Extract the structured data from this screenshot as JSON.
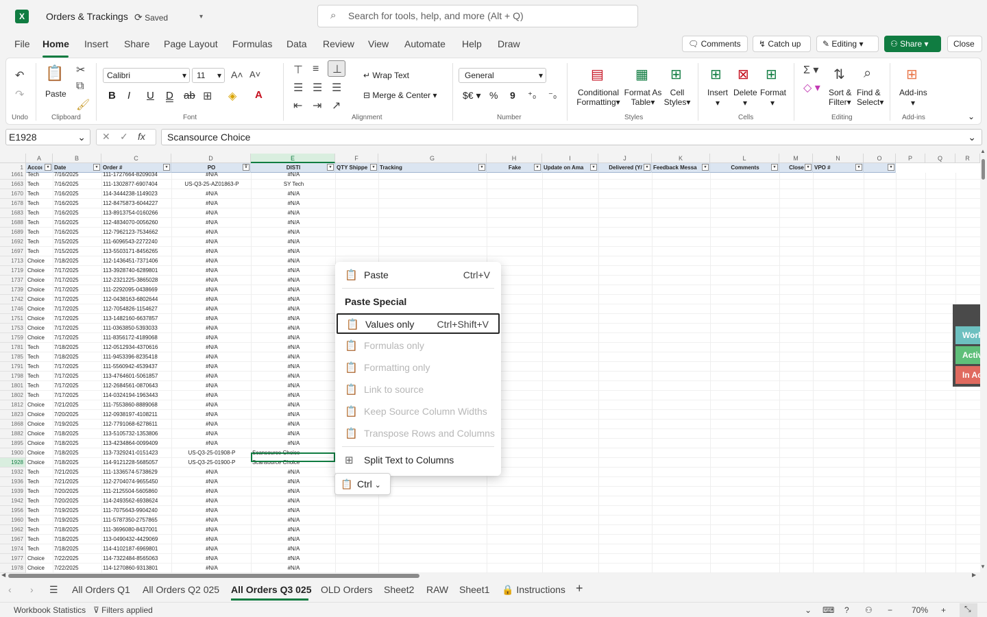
{
  "title_bar": {
    "app_logo": "X",
    "doc_title": "Orders & Trackings",
    "saved_label": "Saved",
    "search_placeholder": "Search for tools, help, and more (Alt + Q)"
  },
  "menu": [
    "File",
    "Home",
    "Insert",
    "Share",
    "Page Layout",
    "Formulas",
    "Data",
    "Review",
    "View",
    "Automate",
    "Help",
    "Draw"
  ],
  "top_buttons": {
    "comments": "Comments",
    "catch_up": "Catch up",
    "editing": "Editing",
    "share": "Share",
    "close": "Close"
  },
  "ribbon": {
    "undo_group": "Undo",
    "paste": "Paste",
    "clipboard_group": "Clipboard",
    "font_name": "Calibri",
    "font_size": "11",
    "font_group": "Font",
    "wrap_text": "Wrap Text",
    "merge_center": "Merge & Center",
    "alignment_group": "Alignment",
    "number_format": "General",
    "number_group": "Number",
    "conditional_formatting": "Conditional",
    "conditional_formatting2": "Formatting",
    "format_as_table": "Format As",
    "format_as_table2": "Table",
    "cell_styles": "Cell",
    "cell_styles2": "Styles",
    "styles_group": "Styles",
    "insert": "Insert",
    "delete": "Delete",
    "format": "Format",
    "cells_group": "Cells",
    "sort_filter": "Sort &",
    "sort_filter2": "Filter",
    "find_select": "Find &",
    "find_select2": "Select",
    "editing_group": "Editing",
    "addins": "Add-ins",
    "addins_group": "Add-ins"
  },
  "formula_bar": {
    "name_box": "E1928",
    "fx": "fx",
    "value": "Scansource Choice"
  },
  "columns": [
    "A",
    "B",
    "C",
    "D",
    "E",
    "F",
    "G",
    "H",
    "I",
    "J",
    "K",
    "L",
    "M",
    "N",
    "O",
    "P",
    "Q",
    "R"
  ],
  "header_row": {
    "row_num": "1",
    "cells": [
      "Accoι",
      "Date",
      "Order #",
      "PO",
      "DISTI",
      "QTY Shippe",
      "Tracking",
      "Fake",
      "Update on Ama",
      "Delivered (Y/",
      "Feedback Messa",
      "Comments",
      "Close",
      "VPO #",
      ""
    ]
  },
  "rows": [
    {
      "n": "1661",
      "a": "Tech",
      "b": "7/16/2025",
      "c": "111-1727664-8209034",
      "d": "#N/A",
      "e": "#N/A"
    },
    {
      "n": "1663",
      "a": "Tech",
      "b": "7/16/2025",
      "c": "111-1302877-6907404",
      "d": "US-Q3-25-AZ01863-P",
      "e": "SY Tech"
    },
    {
      "n": "1670",
      "a": "Tech",
      "b": "7/16/2025",
      "c": "114-3444238-1149023",
      "d": "#N/A",
      "e": "#N/A"
    },
    {
      "n": "1678",
      "a": "Tech",
      "b": "7/16/2025",
      "c": "112-8475873-6044227",
      "d": "#N/A",
      "e": "#N/A"
    },
    {
      "n": "1683",
      "a": "Tech",
      "b": "7/16/2025",
      "c": "113-8913754-0160266",
      "d": "#N/A",
      "e": "#N/A"
    },
    {
      "n": "1688",
      "a": "Tech",
      "b": "7/16/2025",
      "c": "112-4834070-0056260",
      "d": "#N/A",
      "e": "#N/A"
    },
    {
      "n": "1689",
      "a": "Tech",
      "b": "7/16/2025",
      "c": "112-7962123-7534662",
      "d": "#N/A",
      "e": "#N/A"
    },
    {
      "n": "1692",
      "a": "Tech",
      "b": "7/15/2025",
      "c": "111-6096543-2272240",
      "d": "#N/A",
      "e": "#N/A"
    },
    {
      "n": "1697",
      "a": "Tech",
      "b": "7/15/2025",
      "c": "113-5503171-8456265",
      "d": "#N/A",
      "e": "#N/A"
    },
    {
      "n": "1713",
      "a": "Choice",
      "b": "7/18/2025",
      "c": "112-1436451-7371406",
      "d": "#N/A",
      "e": "#N/A"
    },
    {
      "n": "1719",
      "a": "Choice",
      "b": "7/17/2025",
      "c": "113-3928740-6289801",
      "d": "#N/A",
      "e": "#N/A"
    },
    {
      "n": "1737",
      "a": "Choice",
      "b": "7/17/2025",
      "c": "112-2321225-3865028",
      "d": "#N/A",
      "e": "#N/A"
    },
    {
      "n": "1739",
      "a": "Choice",
      "b": "7/17/2025",
      "c": "111-2292095-0438669",
      "d": "#N/A",
      "e": "#N/A"
    },
    {
      "n": "1742",
      "a": "Choice",
      "b": "7/17/2025",
      "c": "112-0438163-6802644",
      "d": "#N/A",
      "e": "#N/A"
    },
    {
      "n": "1746",
      "a": "Choice",
      "b": "7/17/2025",
      "c": "112-7054826-1154627",
      "d": "#N/A",
      "e": "#N/A"
    },
    {
      "n": "1751",
      "a": "Choice",
      "b": "7/17/2025",
      "c": "113-1482160-6637857",
      "d": "#N/A",
      "e": "#N/A"
    },
    {
      "n": "1753",
      "a": "Choice",
      "b": "7/17/2025",
      "c": "111-0363850-5393033",
      "d": "#N/A",
      "e": "#N/A"
    },
    {
      "n": "1759",
      "a": "Choice",
      "b": "7/17/2025",
      "c": "111-8356172-4189068",
      "d": "#N/A",
      "e": "#N/A"
    },
    {
      "n": "1781",
      "a": "Tech",
      "b": "7/18/2025",
      "c": "112-0512934-4370616",
      "d": "#N/A",
      "e": "#N/A"
    },
    {
      "n": "1785",
      "a": "Tech",
      "b": "7/18/2025",
      "c": "111-9453396-8235418",
      "d": "#N/A",
      "e": "#N/A"
    },
    {
      "n": "1791",
      "a": "Tech",
      "b": "7/17/2025",
      "c": "111-5560942-4539437",
      "d": "#N/A",
      "e": "#N/A"
    },
    {
      "n": "1798",
      "a": "Tech",
      "b": "7/17/2025",
      "c": "113-4764601-5061857",
      "d": "#N/A",
      "e": "#N/A"
    },
    {
      "n": "1801",
      "a": "Tech",
      "b": "7/17/2025",
      "c": "112-2684561-0870643",
      "d": "#N/A",
      "e": "#N/A"
    },
    {
      "n": "1802",
      "a": "Tech",
      "b": "7/17/2025",
      "c": "114-0324194-1963443",
      "d": "#N/A",
      "e": "#N/A"
    },
    {
      "n": "1812",
      "a": "Choice",
      "b": "7/21/2025",
      "c": "111-7553860-8889068",
      "d": "#N/A",
      "e": "#N/A"
    },
    {
      "n": "1823",
      "a": "Choice",
      "b": "7/20/2025",
      "c": "112-0938197-4108211",
      "d": "#N/A",
      "e": "#N/A"
    },
    {
      "n": "1868",
      "a": "Choice",
      "b": "7/19/2025",
      "c": "112-7791068-6278611",
      "d": "#N/A",
      "e": "#N/A"
    },
    {
      "n": "1882",
      "a": "Choice",
      "b": "7/18/2025",
      "c": "113-5105732-1353806",
      "d": "#N/A",
      "e": "#N/A"
    },
    {
      "n": "1895",
      "a": "Choice",
      "b": "7/18/2025",
      "c": "113-4234864-0099409",
      "d": "#N/A",
      "e": "#N/A"
    },
    {
      "n": "1900",
      "a": "Choice",
      "b": "7/18/2025",
      "c": "113-7329241-0151423",
      "d": "US-Q3-25-01908-P",
      "e": "Scansource Choice"
    },
    {
      "n": "1928",
      "a": "Choice",
      "b": "7/18/2025",
      "c": "114-9121228-5685057",
      "d": "US-Q3-25-01900-P",
      "e": "Scansource Choice"
    },
    {
      "n": "1932",
      "a": "Tech",
      "b": "7/21/2025",
      "c": "111-1336574-5738629",
      "d": "#N/A",
      "e": "#N/A"
    },
    {
      "n": "1936",
      "a": "Tech",
      "b": "7/21/2025",
      "c": "112-2704074-9655450",
      "d": "#N/A",
      "e": "#N/A"
    },
    {
      "n": "1939",
      "a": "Tech",
      "b": "7/20/2025",
      "c": "111-2125504-5605860",
      "d": "#N/A",
      "e": "#N/A"
    },
    {
      "n": "1942",
      "a": "Tech",
      "b": "7/20/2025",
      "c": "114-2493562-6938624",
      "d": "#N/A",
      "e": "#N/A"
    },
    {
      "n": "1956",
      "a": "Tech",
      "b": "7/19/2025",
      "c": "111-7075643-9904240",
      "d": "#N/A",
      "e": "#N/A"
    },
    {
      "n": "1960",
      "a": "Tech",
      "b": "7/19/2025",
      "c": "111-5787350-2757865",
      "d": "#N/A",
      "e": "#N/A"
    },
    {
      "n": "1962",
      "a": "Tech",
      "b": "7/18/2025",
      "c": "111-3696080-8437001",
      "d": "#N/A",
      "e": "#N/A"
    },
    {
      "n": "1967",
      "a": "Tech",
      "b": "7/18/2025",
      "c": "113-0490432-4429069",
      "d": "#N/A",
      "e": "#N/A"
    },
    {
      "n": "1974",
      "a": "Tech",
      "b": "7/18/2025",
      "c": "114-4102187-6969801",
      "d": "#N/A",
      "e": "#N/A"
    },
    {
      "n": "1977",
      "a": "Choice",
      "b": "7/22/2025",
      "c": "114-7322484-8565063",
      "d": "#N/A",
      "e": "#N/A"
    },
    {
      "n": "1978",
      "a": "Choice",
      "b": "7/22/2025",
      "c": "114-1270860-9313801",
      "d": "#N/A",
      "e": "#N/A"
    }
  ],
  "context_menu": {
    "paste": "Paste",
    "paste_shortcut": "Ctrl+V",
    "paste_special": "Paste Special",
    "values_only": "Values only",
    "values_only_shortcut": "Ctrl+Shift+V",
    "formulas_only": "Formulas only",
    "formatting_only": "Formatting only",
    "link_to_source": "Link to source",
    "keep_source_widths": "Keep Source Column Widths",
    "transpose": "Transpose Rows and Columns",
    "split_text": "Split Text to Columns"
  },
  "ctrl_button": "Ctrl",
  "side_panel": {
    "working": "Working",
    "active": "Active",
    "inactive": "In Active",
    "colors": {
      "working": "#6dc0c0",
      "active": "#5fbf7a",
      "inactive": "#e06a5f"
    }
  },
  "sheet_tabs": [
    "All Orders Q1",
    "All Orders Q2 025",
    "All Orders Q3 025",
    "OLD Orders",
    "Sheet2",
    "RAW",
    "Sheet1",
    "Instructions"
  ],
  "status_bar": {
    "workbook_stats": "Workbook Statistics",
    "filters": "Filters applied",
    "zoom": "70%"
  },
  "colors": {
    "accent": "#107c41"
  }
}
